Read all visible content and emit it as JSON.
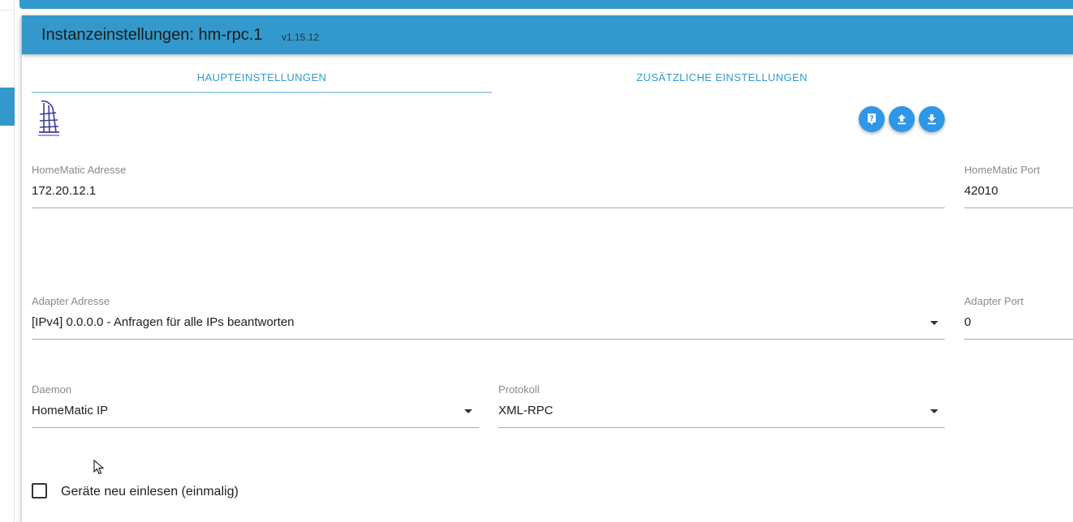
{
  "header": {
    "title": "Instanzeinstellungen: hm-rpc.1",
    "version": "v1.15.12"
  },
  "tabs": [
    {
      "label": "HAUPTEINSTELLUNGEN",
      "active": true
    },
    {
      "label": "ZUSÄTZLICHE EINSTELLUNGEN",
      "active": false
    }
  ],
  "actions": {
    "help_icon": "help-icon",
    "upload_icon": "upload-icon",
    "download_icon": "download-icon"
  },
  "fields": {
    "homematic_address": {
      "label": "HomeMatic Adresse",
      "value": "172.20.12.1"
    },
    "homematic_port": {
      "label": "HomeMatic Port",
      "value": "42010"
    },
    "adapter_address": {
      "label": "Adapter Adresse",
      "value": "[IPv4] 0.0.0.0 - Anfragen für alle IPs beantworten"
    },
    "adapter_port": {
      "label": "Adapter Port",
      "value": "0"
    },
    "daemon": {
      "label": "Daemon",
      "value": "HomeMatic IP"
    },
    "protocol": {
      "label": "Protokoll",
      "value": "XML-RPC"
    }
  },
  "options": {
    "reread_devices": {
      "label": "Geräte neu einlesen (einmalig)",
      "checked": false
    }
  },
  "colors": {
    "accent": "#3399cc",
    "fab": "#2e97e8",
    "tab_text": "#3399cc"
  }
}
